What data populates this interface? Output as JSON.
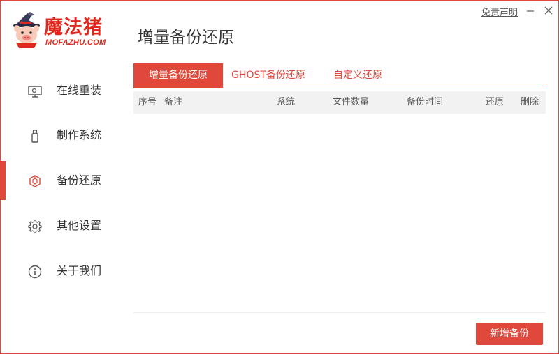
{
  "app": {
    "brand_cn": "魔法猪",
    "brand_en": "MOFAZHU.COM",
    "accent_color": "#e0483c"
  },
  "window": {
    "disclaimer_link": "免责声明",
    "minimize_icon": "minimize-icon",
    "close_icon": "close-icon"
  },
  "sidebar": {
    "items": [
      {
        "label": "在线重装",
        "icon": "monitor-icon",
        "active": false
      },
      {
        "label": "制作系统",
        "icon": "usb-drive-icon",
        "active": false
      },
      {
        "label": "备份还原",
        "icon": "backup-cube-icon",
        "active": true
      },
      {
        "label": "其他设置",
        "icon": "gear-icon",
        "active": false
      },
      {
        "label": "关于我们",
        "icon": "info-icon",
        "active": false
      }
    ]
  },
  "main": {
    "title": "增量备份还原",
    "tabs": [
      {
        "label": "增量备份还原",
        "active": true
      },
      {
        "label": "GHOST备份还原",
        "active": false
      },
      {
        "label": "自定义还原",
        "active": false
      }
    ],
    "table": {
      "columns": [
        "序号",
        "备注",
        "系统",
        "文件数量",
        "备份时间",
        "还原",
        "删除"
      ],
      "rows": []
    },
    "add_backup_label": "新增备份"
  }
}
